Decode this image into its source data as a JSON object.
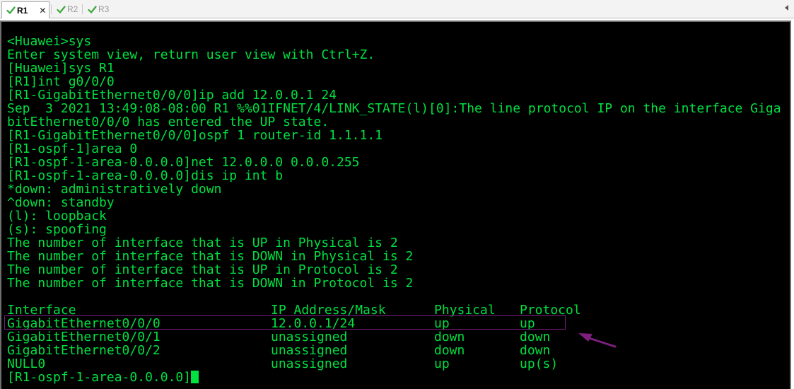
{
  "tabs": [
    {
      "label": "R1",
      "active": true,
      "closable": true,
      "close_glyph": "✕"
    },
    {
      "label": "R2",
      "active": false,
      "closable": false
    },
    {
      "label": "R3",
      "active": false,
      "closable": false
    }
  ],
  "colors": {
    "terminal_fg": "#00e040",
    "terminal_bg": "#000000",
    "highlight": "#7d1f7d",
    "tab_check": "#3aa63a"
  },
  "terminal": {
    "lines": [
      "<Huawei>sys",
      "Enter system view, return user view with Ctrl+Z.",
      "[Huawei]sys R1",
      "[R1]int g0/0/0",
      "[R1-GigabitEthernet0/0/0]ip add 12.0.0.1 24",
      "Sep  3 2021 13:49:08-08:00 R1 %%01IFNET/4/LINK_STATE(l)[0]:The line protocol IP on the interface Giga",
      "bitEthernet0/0/0 has entered the UP state.",
      "[R1-GigabitEthernet0/0/0]ospf 1 router-id 1.1.1.1",
      "[R1-ospf-1]area 0",
      "[R1-ospf-1-area-0.0.0.0]net 12.0.0.0 0.0.0.255",
      "[R1-ospf-1-area-0.0.0.0]dis ip int b",
      "*down: administratively down",
      "^down: standby",
      "(l): loopback",
      "(s): spoofing",
      "The number of interface that is UP in Physical is 2",
      "The number of interface that is DOWN in Physical is 2",
      "The number of interface that is UP in Protocol is 2",
      "The number of interface that is DOWN in Protocol is 2"
    ],
    "table": {
      "headers": [
        "Interface",
        "IP Address/Mask",
        "Physical",
        "Protocol"
      ],
      "rows": [
        [
          "GigabitEthernet0/0/0",
          "12.0.0.1/24",
          "up",
          "up"
        ],
        [
          "GigabitEthernet0/0/1",
          "unassigned",
          "down",
          "down"
        ],
        [
          "GigabitEthernet0/0/2",
          "unassigned",
          "down",
          "down"
        ],
        [
          "NULL0",
          "unassigned",
          "up",
          "up(s)"
        ]
      ],
      "highlighted_row": 0
    },
    "prompt": "[R1-ospf-1-area-0.0.0.0]"
  }
}
